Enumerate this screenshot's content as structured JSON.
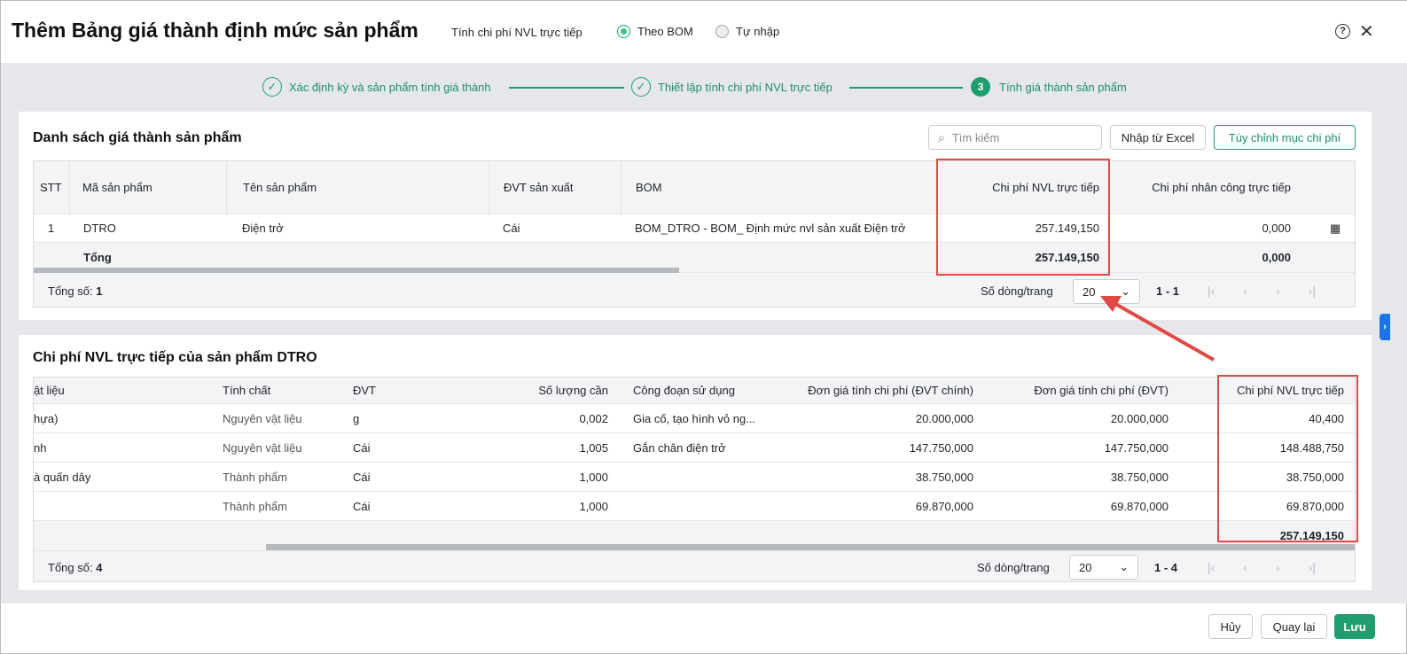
{
  "header": {
    "title": "Thêm Bảng giá thành định mức sản phẩm",
    "method_label": "Tính chi phí NVL trực tiếp",
    "options": [
      "Theo BOM",
      "Tự nhập"
    ],
    "selected": "Theo BOM"
  },
  "steps": [
    {
      "label": "Xác định kỳ và sản phẩm tính giá thành",
      "state": "done"
    },
    {
      "label": "Thiết lập tính chi phí NVL trực tiếp",
      "state": "done"
    },
    {
      "number": "3",
      "label": "Tính giá thành sản phẩm",
      "state": "active"
    }
  ],
  "products": {
    "title": "Danh sách giá thành sản phẩm",
    "search_placeholder": "Tìm kiếm",
    "import_label": "Nhập từ Excel",
    "customize_label": "Tùy chỉnh mục chi phí",
    "columns": [
      "STT",
      "Mã sản phẩm",
      "Tên sản phẩm",
      "ĐVT sản xuất",
      "BOM",
      "Chi phí NVL trực tiếp",
      "Chi phí nhân công trực tiếp"
    ],
    "rows": [
      {
        "stt": "1",
        "code": "DTRO",
        "name": "Điện trở",
        "unit": "Cái",
        "bom": "BOM_DTRO - BOM_ Định mức nvl sản xuất Điện trở",
        "nvl": "257.149,150",
        "labor": "0,000"
      }
    ],
    "total": {
      "label": "Tổng",
      "nvl": "257.149,150",
      "labor": "0,000"
    },
    "footer": {
      "total_label": "Tổng số:",
      "total_count": "1",
      "page_size_label": "Số dòng/trang",
      "page_size": "20",
      "range": "1 - 1"
    }
  },
  "materials": {
    "title": "Chi phí NVL trực tiếp của sản phẩm DTRO",
    "columns": [
      "ật liệu",
      "Tính chất",
      "ĐVT",
      "Số lượng cần",
      "Công đoạn sử dụng",
      "Đơn giá tính chi phí (ĐVT chính)",
      "Đơn giá tính chi phí (ĐVT)",
      "Chi phí NVL trực tiếp"
    ],
    "rows": [
      [
        "hựa)",
        "Nguyên vật liệu",
        "g",
        "0,002",
        "Gia cố, tạo hình vỏ ng...",
        "20.000,000",
        "20.000,000",
        "40,400"
      ],
      [
        "nh",
        "Nguyên vật liệu",
        "Cái",
        "1,005",
        "Gắn chân điện trở",
        "147.750,000",
        "147.750,000",
        "148.488,750"
      ],
      [
        "à quấn dây",
        "Thành phẩm",
        "Cái",
        "1,000",
        "",
        "38.750,000",
        "38.750,000",
        "38.750,000"
      ],
      [
        "",
        "Thành phẩm",
        "Cái",
        "1,000",
        "",
        "69.870,000",
        "69.870,000",
        "69.870,000"
      ]
    ],
    "total_nvl": "257.149,150",
    "footer": {
      "total_label": "Tổng số:",
      "total_count": "4",
      "page_size_label": "Số dòng/trang",
      "page_size": "20",
      "range": "1 - 4"
    }
  },
  "actions": {
    "cancel": "Hủy",
    "back": "Quay lại",
    "save": "Lưu"
  },
  "colors": {
    "accent": "#1e9e6f",
    "highlight": "#e04a45"
  }
}
